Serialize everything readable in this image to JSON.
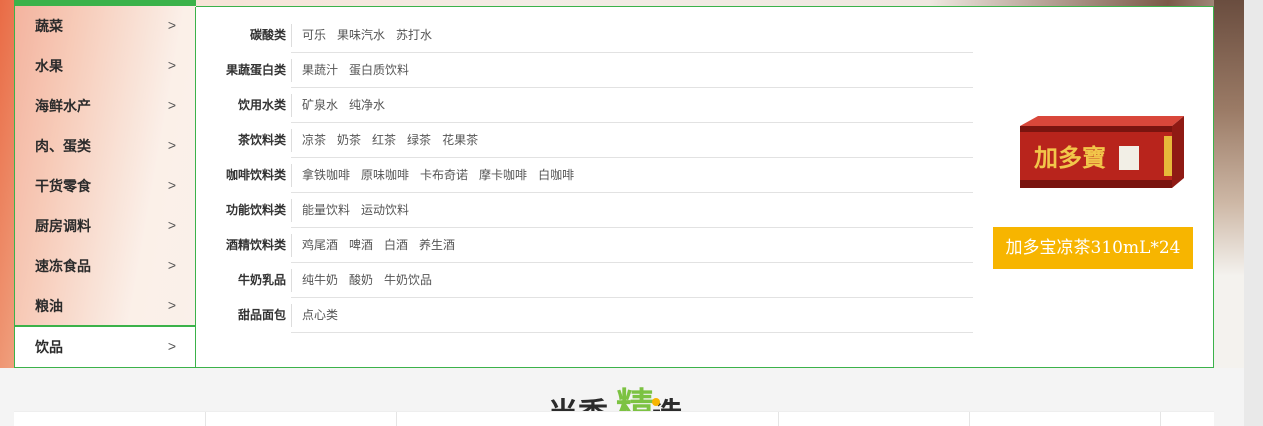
{
  "categories": [
    {
      "label": "蔬菜"
    },
    {
      "label": "水果"
    },
    {
      "label": "海鲜水产"
    },
    {
      "label": "肉、蛋类"
    },
    {
      "label": "干货零食"
    },
    {
      "label": "厨房调料"
    },
    {
      "label": "速冻食品"
    },
    {
      "label": "粮油"
    },
    {
      "label": "饮品"
    }
  ],
  "chevron": ">",
  "subcategories": [
    {
      "label": "碳酸类",
      "items": [
        "可乐",
        "果味汽水",
        "苏打水"
      ]
    },
    {
      "label": "果蔬蛋白类",
      "items": [
        "果蔬汁",
        "蛋白质饮料"
      ]
    },
    {
      "label": "饮用水类",
      "items": [
        "矿泉水",
        "纯净水"
      ]
    },
    {
      "label": "茶饮料类",
      "items": [
        "凉茶",
        "奶茶",
        "红茶",
        "绿茶",
        "花果茶"
      ]
    },
    {
      "label": "咖啡饮料类",
      "items": [
        "拿铁咖啡",
        "原味咖啡",
        "卡布奇诺",
        "摩卡咖啡",
        "白咖啡"
      ]
    },
    {
      "label": "功能饮料类",
      "items": [
        "能量饮料",
        "运动饮料"
      ]
    },
    {
      "label": "酒精饮料类",
      "items": [
        "鸡尾酒",
        "啤酒",
        "白酒",
        "养生酒"
      ]
    },
    {
      "label": "牛奶乳品",
      "items": [
        "纯牛奶",
        "酸奶",
        "牛奶饮品"
      ]
    },
    {
      "label": "甜品面包",
      "items": [
        "点心类"
      ]
    }
  ],
  "promo": {
    "product_name": "加多宝凉茶310mL*24",
    "box_brand": "加多寶",
    "colors": {
      "box": "#b8241c",
      "label_bg": "#f7b500"
    }
  },
  "section_title": {
    "part1": "当季",
    "part2": "精",
    "part3": "选",
    "accent": "#7cc242"
  }
}
